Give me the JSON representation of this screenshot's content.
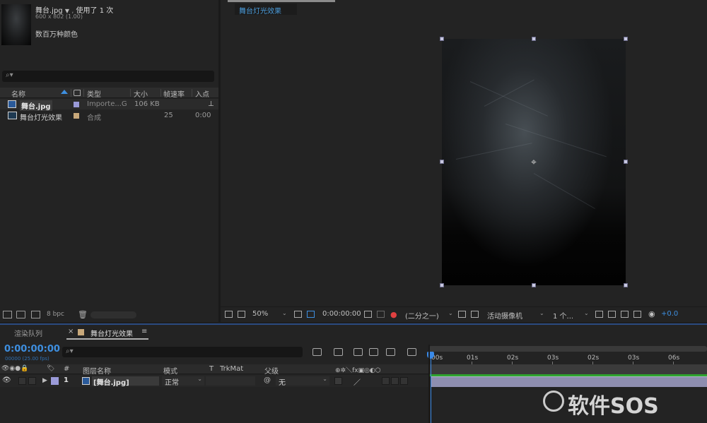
{
  "project": {
    "file_name": "舞台.jpg",
    "file_name_suffix": "▼",
    "usage": "使用了 1 次",
    "dimensions": "600 x 802 (1.00)",
    "color_depth": "数百万种颜色",
    "search_icon": "⌕▾",
    "columns": {
      "name": "名称",
      "type": "类型",
      "size": "大小",
      "fps": "帧速率",
      "in": "入点"
    },
    "rows": [
      {
        "name": "舞台.jpg",
        "type": "Importe...G",
        "size": "106 KB",
        "fps": "",
        "in": ""
      },
      {
        "name": "舞台灯光效果",
        "type": "合成",
        "size": "",
        "fps": "25",
        "in": "0:00"
      }
    ],
    "bpc": "8 bpc",
    "swatch_colors": [
      "#9a9ad8",
      "#c8a87a"
    ]
  },
  "viewer": {
    "tab": "舞台灯光效果",
    "zoom": "50%",
    "timecode": "0:00:00:00",
    "resolution": "(二分之一)",
    "camera": "活动摄像机",
    "views": "1 个...",
    "exposure": "+0.0"
  },
  "timeline": {
    "render_queue_tab": "渲染队列",
    "close_symbol": "×",
    "comp_tab": "舞台灯光效果",
    "menu_symbol": "≡",
    "timecode": "0:00:00:00",
    "fps": "00000 (25.00 fps)",
    "search_icon": "⌕▾",
    "headers": {
      "switches": "👁◉●🔒",
      "label": "🏷",
      "number": "#",
      "name": "图层名称",
      "mode": "模式",
      "t": "T",
      "trkmat": "TrkMat",
      "parent": "父级",
      "layer_switches": "⊕✲＼fx▣◎◐⬡"
    },
    "layer": {
      "number": "1",
      "name": "[舞台.jpg]",
      "mode": "正常",
      "parent": "无"
    },
    "ruler_labels": [
      "00s",
      "01s",
      "02s",
      "03s",
      "02s",
      "03s",
      "06s"
    ],
    "accent": "#3e8fe0"
  },
  "watermark": "软件SOS"
}
